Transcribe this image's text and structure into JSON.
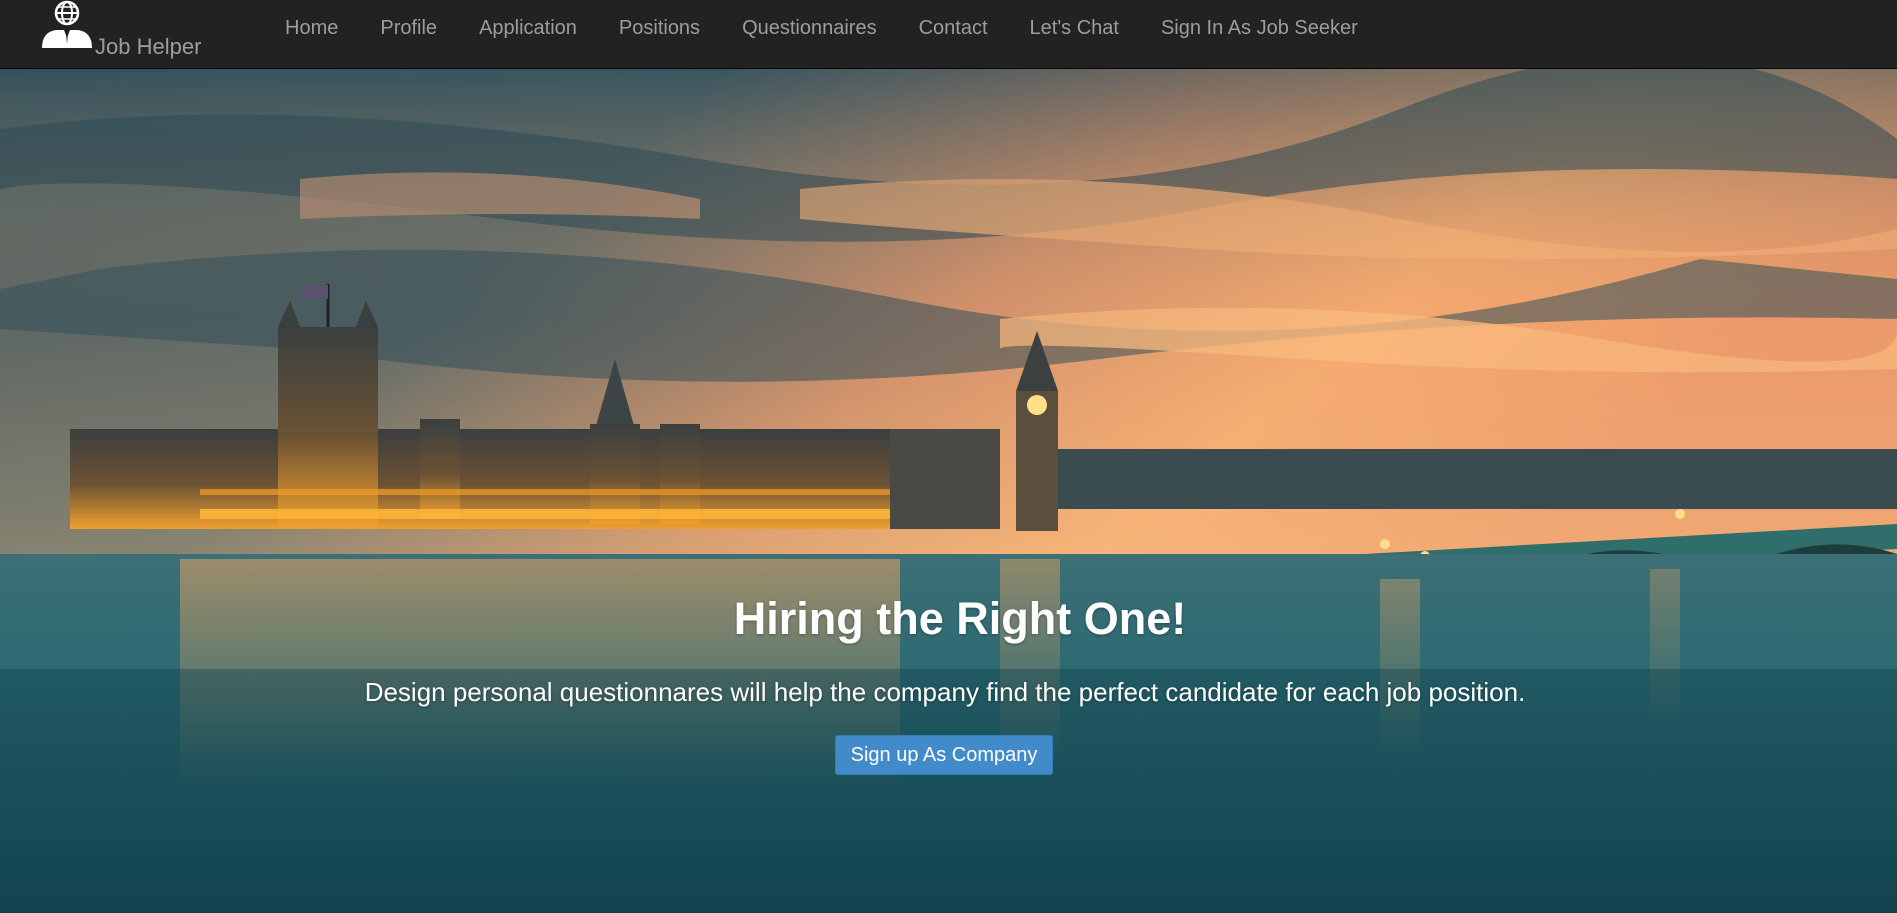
{
  "navbar": {
    "brand_text": "Job Helper",
    "brand_icon": "job-seeker-globe-icon",
    "links": [
      {
        "label": "Home"
      },
      {
        "label": "Profile"
      },
      {
        "label": "Application"
      },
      {
        "label": "Positions"
      },
      {
        "label": "Questionnaires"
      },
      {
        "label": "Contact"
      },
      {
        "label": "Let's Chat"
      },
      {
        "label": "Sign In As Job Seeker"
      }
    ]
  },
  "hero": {
    "title": "Hiring the Right One!",
    "subtitle": "Design personal questionnares will help the company find the perfect candidate for each job position.",
    "button_label": "Sign up As Company",
    "background_image": "london-westminster-sunset-photo"
  },
  "colors": {
    "navbar_bg": "#222222",
    "nav_text": "#9d9d9d",
    "button_bg": "#428bca",
    "hero_text": "#ffffff"
  }
}
